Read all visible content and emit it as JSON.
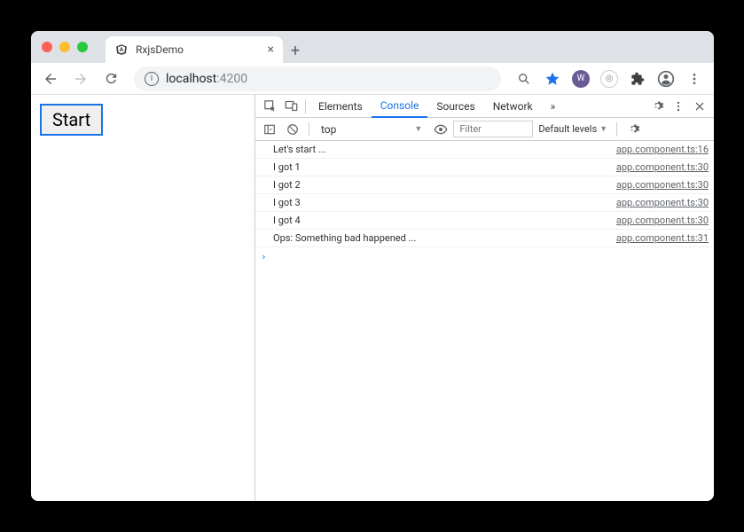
{
  "browser": {
    "tab_title": "RxjsDemo",
    "url_host": "localhost",
    "url_port": ":4200"
  },
  "page": {
    "start_button": "Start"
  },
  "devtools": {
    "tabs": {
      "elements": "Elements",
      "console": "Console",
      "sources": "Sources",
      "network": "Network"
    },
    "more": "»",
    "context": "top",
    "filter_placeholder": "Filter",
    "levels": "Default levels",
    "log": [
      {
        "msg": "Let's start ...",
        "src": "app.component.ts:16"
      },
      {
        "msg": "I got 1",
        "src": "app.component.ts:30"
      },
      {
        "msg": "I got 2",
        "src": "app.component.ts:30"
      },
      {
        "msg": "I got 3",
        "src": "app.component.ts:30"
      },
      {
        "msg": "I got 4",
        "src": "app.component.ts:30"
      },
      {
        "msg": "Ops: Something bad happened ...",
        "src": "app.component.ts:31"
      }
    ]
  }
}
